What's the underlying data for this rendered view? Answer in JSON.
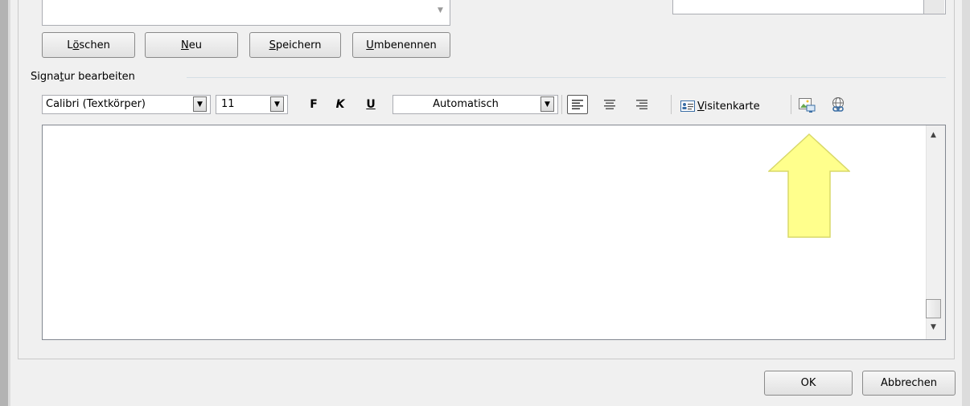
{
  "signature_buttons": {
    "delete_pre": "L",
    "delete_key": "ö",
    "delete_post": "schen",
    "new_key": "N",
    "new_post": "eu",
    "save_key": "S",
    "save_post": "peichern",
    "rename_key": "U",
    "rename_post": "mbenennen"
  },
  "edit_section": {
    "label_pre": "Signa",
    "label_key": "t",
    "label_post": "ur bearbeiten"
  },
  "toolbar": {
    "font_family": "Calibri (Textkörper)",
    "font_size": "11",
    "bold_label": "F",
    "italic_label": "K",
    "underline_label": "U",
    "font_color": "Automatisch",
    "vcard_key": "V",
    "vcard_post": "isitenkarte",
    "icons": [
      "align-left-icon",
      "align-center-icon",
      "align-right-icon",
      "business-card-icon",
      "insert-picture-icon",
      "insert-hyperlink-icon"
    ]
  },
  "dialog": {
    "ok_label": "OK",
    "cancel_label": "Abbrechen"
  },
  "colors": {
    "annotation_arrow": "#ffff8c",
    "annotation_arrow_border": "#d9d96a"
  }
}
